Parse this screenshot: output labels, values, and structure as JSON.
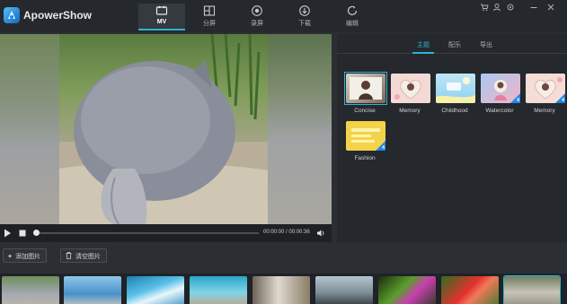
{
  "app": {
    "title": "ApowerShow",
    "accent": "#2bb4d8"
  },
  "mode_tabs": [
    {
      "label": "MV",
      "icon": "mv-icon"
    },
    {
      "label": "分屏",
      "icon": "split-screen-icon"
    },
    {
      "label": "录屏",
      "icon": "record-screen-icon"
    },
    {
      "label": "下载",
      "icon": "download-icon"
    },
    {
      "label": "编辑",
      "icon": "edit-icon"
    }
  ],
  "window_controls": [
    "cart-icon",
    "user-icon",
    "settings-icon",
    "minimize-icon",
    "close-icon"
  ],
  "player": {
    "time": "00:00:00 / 00:00:36",
    "progress": 0.0
  },
  "panel_tabs": [
    {
      "label": "主题"
    },
    {
      "label": "配乐"
    },
    {
      "label": "导出"
    }
  ],
  "themes": [
    {
      "label": "Concise",
      "badge": ""
    },
    {
      "label": "Memory",
      "badge": ""
    },
    {
      "label": "Childhood",
      "badge": ""
    },
    {
      "label": "Watercolor",
      "badge": "4"
    },
    {
      "label": "Memory",
      "badge": "4"
    },
    {
      "label": "Fashion",
      "badge": "4"
    }
  ],
  "toolbar": {
    "add_label": "添加图片",
    "add_prefix": "+",
    "clear_label": "清空图片"
  }
}
